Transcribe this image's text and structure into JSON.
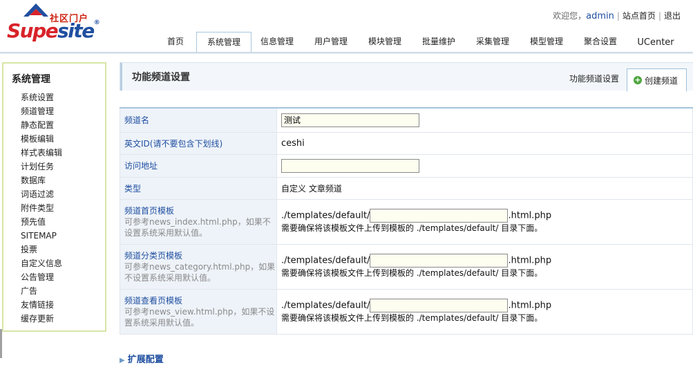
{
  "logo": {
    "cn_text": "社区门户",
    "brand_a": "Supe",
    "brand_b": "site",
    "reg": "®"
  },
  "toplinks": {
    "welcome": "欢迎您，",
    "user": "admin",
    "home": "站点首页",
    "logout": "退出"
  },
  "nav": [
    {
      "label": "首页"
    },
    {
      "label": "系统管理",
      "active": true
    },
    {
      "label": "信息管理"
    },
    {
      "label": "用户管理"
    },
    {
      "label": "模块管理"
    },
    {
      "label": "批量维护"
    },
    {
      "label": "采集管理"
    },
    {
      "label": "模型管理"
    },
    {
      "label": "聚合设置"
    },
    {
      "label": "UCenter"
    }
  ],
  "sidebar": {
    "title": "系统管理",
    "items": [
      "系统设置",
      "频道管理",
      "静态配置",
      "模板编辑",
      "样式表编辑",
      "计划任务",
      "数据库",
      "词语过滤",
      "附件类型",
      "预先值",
      "SITEMAP",
      "投票",
      "自定义信息",
      "公告管理",
      "广告",
      "友情链接",
      "缓存更新"
    ]
  },
  "content": {
    "title": "功能频道设置",
    "settings_link": "功能频道设置",
    "create_button": "创建频道"
  },
  "form": {
    "channel_name": {
      "label": "频道名",
      "value": "测试"
    },
    "english_id": {
      "label": "英文ID(请不要包含下划线)",
      "value": "ceshi"
    },
    "access_url": {
      "label": "访问地址",
      "value": ""
    },
    "type": {
      "label": "类型",
      "value": "自定义 文章频道"
    },
    "template_prefix": "./templates/default/",
    "template_suffix": ".html.php",
    "template_note": "需要确保将该模板文件上传到模板的 ./templates/default/ 目录下面。",
    "index_tpl": {
      "label": "频道首页模板",
      "hint": "可参考news_index.html.php，如果不设置系统采用默认值。",
      "value": ""
    },
    "category_tpl": {
      "label": "频道分类页模板",
      "hint": "可参考news_category.html.php，如果不设置系统采用默认值。",
      "value": ""
    },
    "view_tpl": {
      "label": "频道查看页模板",
      "hint": "可参考news_view.html.php，如果不设置系统采用默认值。",
      "value": ""
    }
  },
  "bottom_link": "扩展配置",
  "colors": {
    "brand_red": "#d8232a",
    "brand_blue": "#1f4fa0",
    "sidebar_border": "#d6e6a6",
    "table_top": "#a6c3dc"
  }
}
